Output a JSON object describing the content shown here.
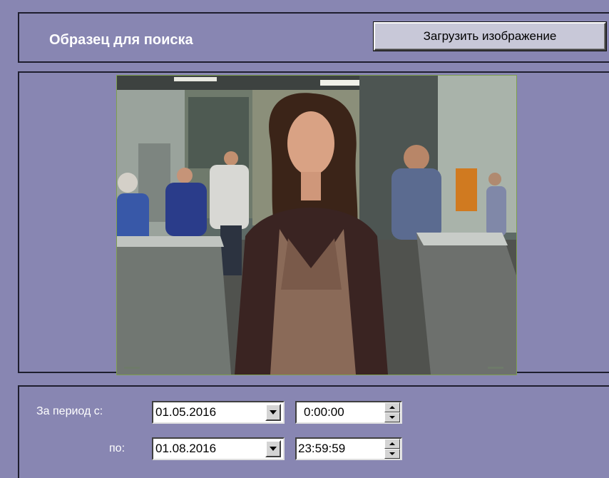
{
  "header": {
    "title": "Образец для поиска",
    "load_button_label": "Загрузить изображение"
  },
  "image": {
    "description_icon": "photo-icon"
  },
  "period": {
    "from_label": "За период с:",
    "to_label": "по:",
    "from_date": "01.05.2016",
    "from_time": "0:00:00",
    "to_date": "01.08.2016",
    "to_time": "23:59:59"
  }
}
